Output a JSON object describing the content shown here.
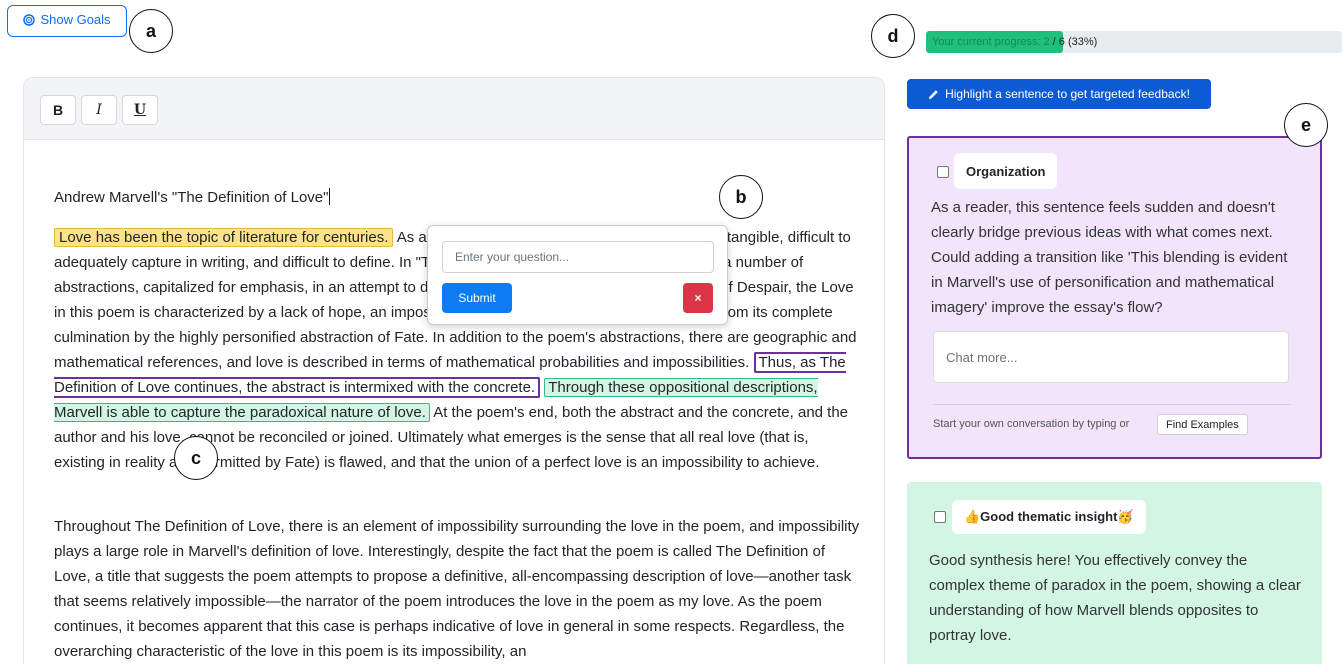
{
  "goals_button": {
    "label": "Show Goals",
    "icon": "target-icon",
    "color": "#0d6efd"
  },
  "markers": {
    "a": "a",
    "b": "b",
    "c": "c",
    "d": "d",
    "e": "e"
  },
  "progress": {
    "lead": "Your current progress: 2",
    "rest": " / 6 (33%)",
    "current": 2,
    "total": 6,
    "percent": 33,
    "fill_color": "#20c07a"
  },
  "toolbar": {
    "bold": "B",
    "italic": "I",
    "underline": "U"
  },
  "document": {
    "title": "Andrew Marvell's \"The Definition of Love\"",
    "para1": {
      "s1": "Love has been the topic of literature for centuries.",
      "s2": " As a concept, it is at once ephemeral, complex, intangible, difficult to adequately capture in writing, and difficult to define. In \"The Definition of Love,\" Andrew Marvell uses a number of abstractions, capitalized for emphasis, in an attempt to describe the love in question: Love. Born out of Despair, the Love in this poem is characterized by a lack of hope, an impossibility of Hope, and is ultimately prohibited from its complete culmination by the highly personified abstraction of Fate. In addition to the poem's abstractions, there are geographic and mathematical references, and love is described in terms of mathematical probabilities and impossibilities. ",
      "s3": "Thus, as The Definition of Love continues, the abstract is intermixed with the concrete.",
      "s4": "Through these oppositional descriptions, Marvell is able to capture the paradoxical nature of love.",
      "s5": " At the poem's end, both the abstract and the concrete, and the author and his love, cannot be reconciled or joined. Ultimately what emerges is the sense that all real love (that is, existing in reality and permitted by Fate) is flawed, and that the union of a perfect love is an impossibility to achieve."
    },
    "para2": " Throughout The Definition of Love, there is an element of impossibility surrounding the love in the poem, and impossibility plays a large role in Marvell's definition of love. Interestingly, despite the fact that the poem is called The Definition of Love, a title that suggests the poem attempts to propose a definitive, all-encompassing description of love—another task that seems relatively impossible—the narrator of the poem introduces the love in the poem as  my love. As the poem continues, it becomes apparent that this case is perhaps indicative of love in general in some respects. Regardless, the overarching characteristic of the love in this poem is its impossibility, an"
  },
  "question_popover": {
    "placeholder": "Enter your question...",
    "submit": "Submit",
    "close": "×"
  },
  "highlight_button": {
    "label": "Highlight a sentence to get targeted feedback!",
    "icon": "pencil-icon"
  },
  "cards": [
    {
      "tag": "Organization",
      "body": "As a reader, this sentence feels sudden and doesn't clearly bridge previous ideas with what comes next. Could adding a transition like 'This blending is evident in Marvell's use of personification and mathematical imagery' improve the essay's flow?",
      "chat_placeholder": "Chat more...",
      "start_text": "Start your own conversation by typing or",
      "find_button": "Find Examples",
      "color": "#f1e4fb",
      "border": "#6b2fa0"
    },
    {
      "tag": "👍Good thematic insight🥳",
      "body": "Good synthesis here! You effectively convey the complex theme of paradox in the poem, showing a clear understanding of how Marvell blends opposites to portray love.",
      "color": "#d3f5e4"
    }
  ]
}
